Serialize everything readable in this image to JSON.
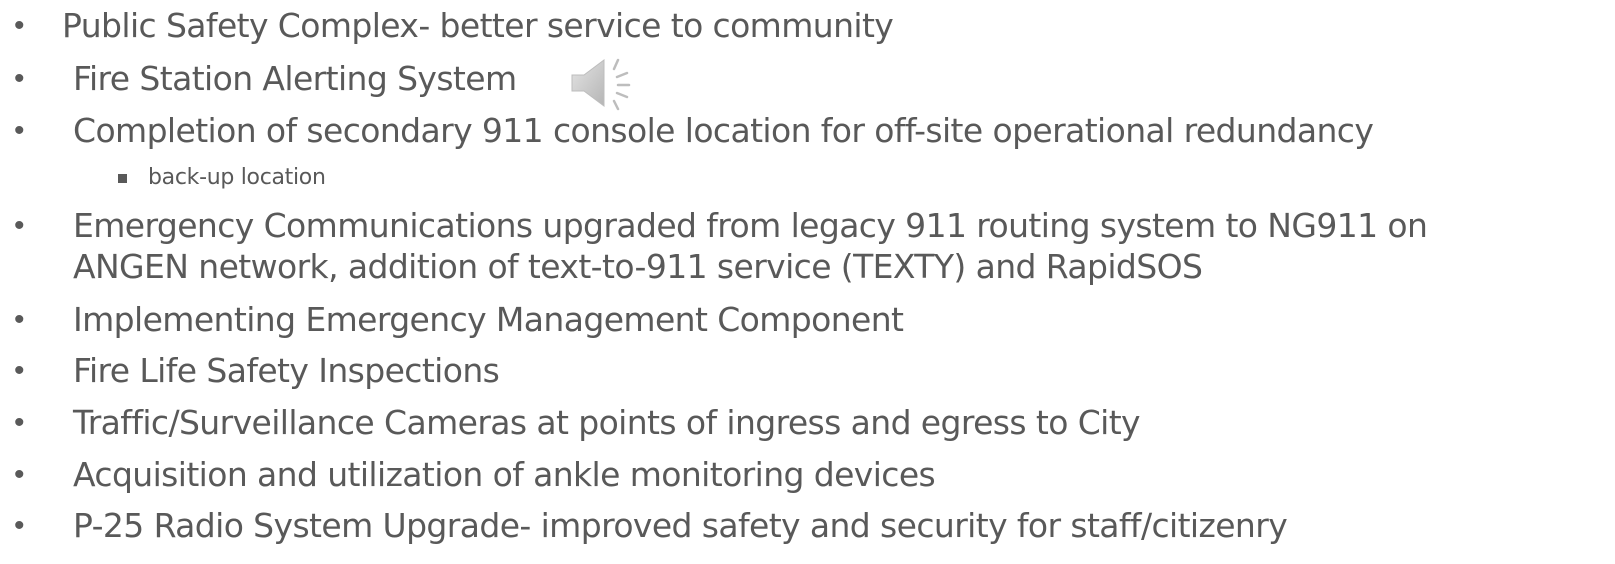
{
  "bullets": [
    {
      "marker": "•",
      "text": "Public Safety Complex- better service to community"
    },
    {
      "marker": "•",
      "text": "Fire Station Alerting System",
      "icon": "speaker-icon"
    },
    {
      "marker": "•",
      "text": "Completion of secondary 911 console location for off-site operational redundancy",
      "sub": [
        {
          "text": "back-up location"
        }
      ]
    },
    {
      "marker": "•",
      "lines": [
        "Emergency Communications upgraded from legacy 911 routing system to NG911 on",
        "ANGEN network, addition of text-to-911 service (TEXTY) and RapidSOS"
      ]
    },
    {
      "marker": "•",
      "text": "Implementing Emergency Management Component"
    },
    {
      "marker": "•",
      "text": "Fire Life Safety Inspections"
    },
    {
      "marker": "•",
      "text": "Traffic/Surveillance Cameras at points of ingress and egress to City"
    },
    {
      "marker": "•",
      "text": "Acquisition and utilization of ankle monitoring devices"
    },
    {
      "marker": "•",
      "text": "P-25 Radio System Upgrade- improved safety and security for staff/citizenry"
    }
  ]
}
